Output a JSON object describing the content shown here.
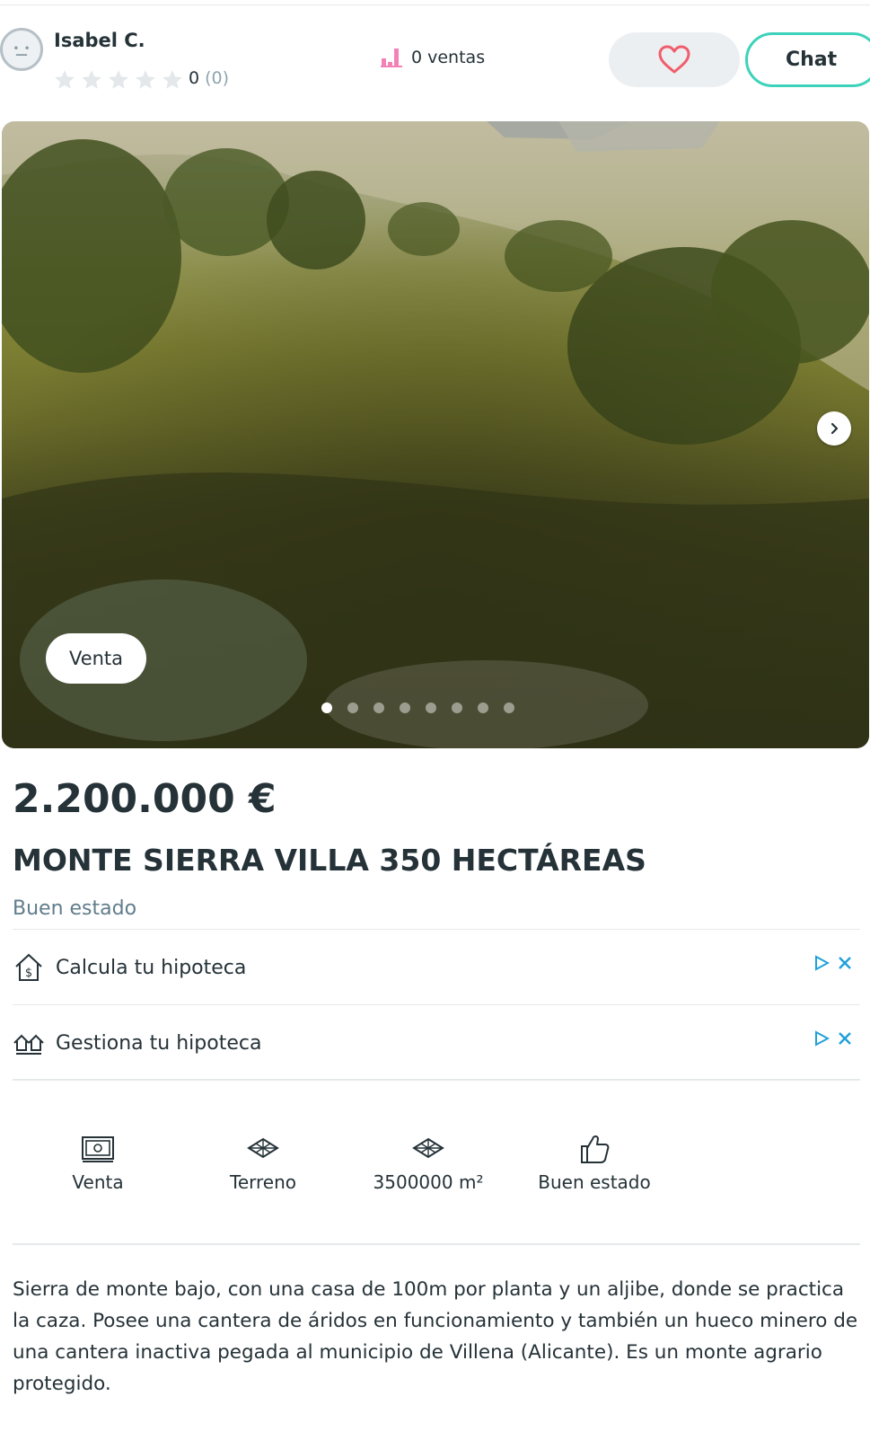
{
  "seller": {
    "name": "Isabel C.",
    "rating_value": "0",
    "rating_paren": "(0)",
    "stars": 0,
    "sales_label": "0 ventas"
  },
  "actions": {
    "favorite_icon": "heart-icon",
    "chat_label": "Chat"
  },
  "gallery": {
    "badge": "Venta",
    "image_count": 8,
    "active_index": 0,
    "next_icon": "chevron-right-icon"
  },
  "listing": {
    "price": "2.200.000 €",
    "title": "MONTE SIERRA VILLA 350 HECTÁREAS",
    "condition": "Buen estado"
  },
  "ads": [
    {
      "label": "Calcula tu hipoteca",
      "icon": "house-dollar-icon"
    },
    {
      "label": "Gestiona tu hipoteca",
      "icon": "houses-icon"
    }
  ],
  "attributes": [
    {
      "label": "Venta",
      "icon": "banknote-icon"
    },
    {
      "label": "Terreno",
      "icon": "grid-icon"
    },
    {
      "label": "3500000 m²",
      "icon": "grid-icon"
    },
    {
      "label": "Buen estado",
      "icon": "thumbs-up-icon"
    }
  ],
  "description": "Sierra de monte bajo, con una casa de 100m por planta y un aljibe, donde se practica la caza. Posee una cantera de áridos en funcionamiento y también un hueco minero de una cantera inactiva pegada al municipio de Villena (Alicante). Es un monte agrario protegido.",
  "colors": {
    "accent": "#3dd2ba",
    "heart": "#f05d6c",
    "sales_icon": "#f381b5",
    "ad_mark": "#1fa0d9"
  }
}
